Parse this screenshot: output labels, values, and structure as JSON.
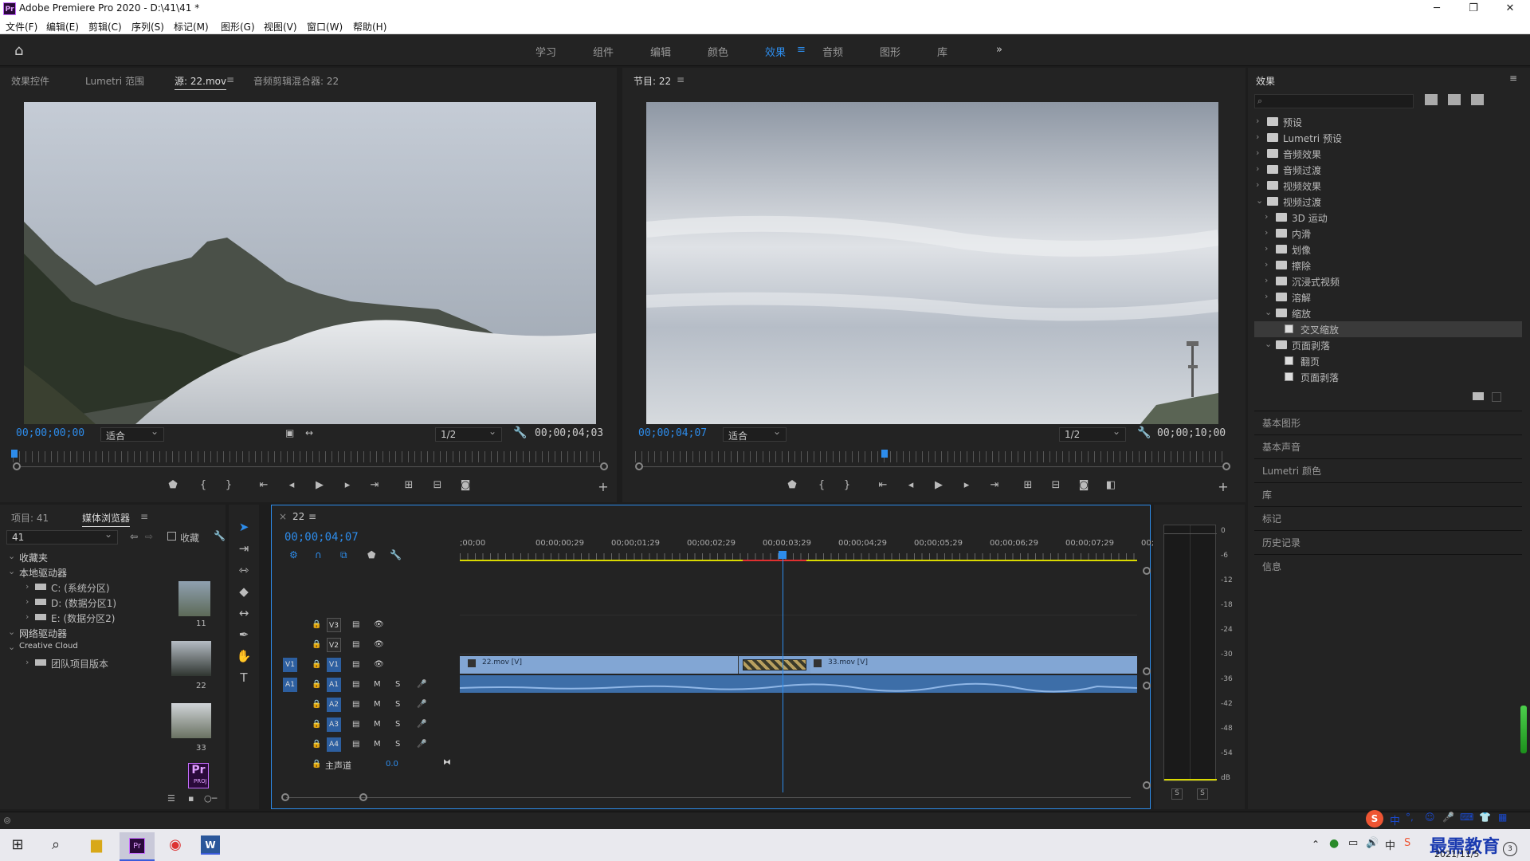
{
  "titlebar": {
    "title": "Adobe Premiere Pro 2020 - D:\\41\\41 *",
    "logo": "Pr",
    "minimize": "─",
    "maximize": "❐",
    "close": "✕"
  },
  "menu": [
    "文件(F)",
    "编辑(E)",
    "剪辑(C)",
    "序列(S)",
    "标记(M)",
    "图形(G)",
    "视图(V)",
    "窗口(W)",
    "帮助(H)"
  ],
  "workspaces": [
    "学习",
    "组件",
    "编辑",
    "颜色",
    "效果",
    "音频",
    "图形",
    "库"
  ],
  "workspaces_active": "效果",
  "source_panel": {
    "tabs": [
      "效果控件",
      "Lumetri 范围",
      "源: 22.mov",
      "音频剪辑混合器: 22"
    ],
    "timecode_in": "00;00;00;00",
    "fit": "适合",
    "resolution": "1/2",
    "duration": "00;00;04;03"
  },
  "program_panel": {
    "title": "节目: 22",
    "timecode": "00;00;04;07",
    "fit": "适合",
    "resolution": "1/2",
    "duration": "00;00;10;00"
  },
  "effects_panel": {
    "title": "效果",
    "tree": [
      {
        "label": "预设",
        "level": 0,
        "open": false,
        "kind": "folder-star"
      },
      {
        "label": "Lumetri 预设",
        "level": 0,
        "open": false,
        "kind": "folder-star"
      },
      {
        "label": "音频效果",
        "level": 0,
        "open": false,
        "kind": "folder"
      },
      {
        "label": "音频过渡",
        "level": 0,
        "open": false,
        "kind": "folder"
      },
      {
        "label": "视频效果",
        "level": 0,
        "open": false,
        "kind": "folder"
      },
      {
        "label": "视频过渡",
        "level": 0,
        "open": true,
        "kind": "folder"
      },
      {
        "label": "3D 运动",
        "level": 1,
        "open": false,
        "kind": "folder"
      },
      {
        "label": "内滑",
        "level": 1,
        "open": false,
        "kind": "folder"
      },
      {
        "label": "划像",
        "level": 1,
        "open": false,
        "kind": "folder"
      },
      {
        "label": "擦除",
        "level": 1,
        "open": false,
        "kind": "folder"
      },
      {
        "label": "沉浸式视频",
        "level": 1,
        "open": false,
        "kind": "folder"
      },
      {
        "label": "溶解",
        "level": 1,
        "open": false,
        "kind": "folder"
      },
      {
        "label": "缩放",
        "level": 1,
        "open": true,
        "kind": "folder"
      },
      {
        "label": "交叉缩放",
        "level": 2,
        "open": false,
        "kind": "fx",
        "selected": true
      },
      {
        "label": "页面剥落",
        "level": 1,
        "open": true,
        "kind": "folder"
      },
      {
        "label": "翻页",
        "level": 2,
        "open": false,
        "kind": "fx"
      },
      {
        "label": "页面剥落",
        "level": 2,
        "open": false,
        "kind": "fx"
      }
    ],
    "sections": [
      "基本图形",
      "基本声音",
      "Lumetri 颜色",
      "库",
      "标记",
      "历史记录",
      "信息"
    ]
  },
  "project_panel": {
    "tabs": [
      "项目: 41",
      "媒体浏览器"
    ],
    "path": "41",
    "bookmark": "收藏",
    "tree": [
      {
        "label": "收藏夹",
        "level": 0
      },
      {
        "label": "本地驱动器",
        "level": 0
      },
      {
        "label": "C: (系统分区)",
        "level": 1
      },
      {
        "label": "D: (数据分区1)",
        "level": 1
      },
      {
        "label": "E: (数据分区2)",
        "level": 1
      },
      {
        "label": "网络驱动器",
        "level": 0
      },
      {
        "label": "Creative Cloud",
        "level": 0
      },
      {
        "label": "团队项目版本",
        "level": 1
      }
    ],
    "thumbs": [
      {
        "label": "11"
      },
      {
        "label": "22"
      },
      {
        "label": "33"
      },
      {
        "label": "PROJ",
        "icon": "Pr"
      }
    ]
  },
  "timeline": {
    "seq_name": "22",
    "timecode": "00;00;04;07",
    "ruler": [
      ";00;00",
      "00;00;00;29",
      "00;00;01;29",
      "00;00;02;29",
      "00;00;03;29",
      "00;00;04;29",
      "00;00;05;29",
      "00;00;06;29",
      "00;00;07;29",
      "00;"
    ],
    "video_tracks": [
      "V3",
      "V2",
      "V1"
    ],
    "audio_tracks": [
      "A1",
      "A2",
      "A3",
      "A4"
    ],
    "master": "主声道",
    "master_val": "0.0",
    "clip1": "22.mov [V]",
    "clip2": "33.mov [V]",
    "src_v": "V1",
    "src_a": "A1",
    "m": "M",
    "s": "S"
  },
  "meter": {
    "scale": [
      "0",
      "-6",
      "-12",
      "-18",
      "-24",
      "-30",
      "-36",
      "-42",
      "-48",
      "-54",
      "dB"
    ],
    "solo": [
      "S",
      "S"
    ]
  },
  "taskbar": {
    "date": "2021/11/5",
    "ime": "中",
    "brand": "最需教育"
  }
}
